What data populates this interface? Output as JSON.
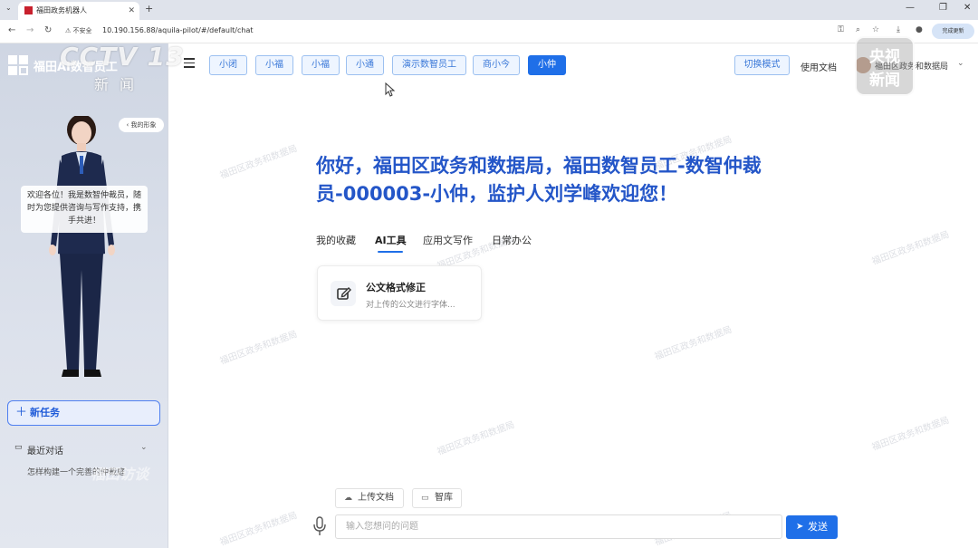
{
  "browser": {
    "tab_title": "福田政务机器人",
    "url_security": "不安全",
    "url": "10.190.156.88/aquila-pilot/#/default/chat",
    "profile_label": "完成更新"
  },
  "sidebar": {
    "brand": "福田AI数智员工",
    "my_avatar": "我的形象",
    "greeting": "欢迎各位！我是数智仲裁员，随时为您提供咨询与写作支持，携手共进！",
    "new_task": "新任务",
    "recent_label": "最近对话",
    "recent_items": [
      "怎样构建一个完善的仲裁庭"
    ]
  },
  "topnav": {
    "agent_tabs": [
      "小闭",
      "小福",
      "小福",
      "小通",
      "演示数智员工",
      "商小今",
      "小仲"
    ],
    "active_tab_index": 6,
    "switch_mode": "切换模式",
    "usage_doc": "使用文档",
    "user_name": "福田区政务和数据局"
  },
  "main": {
    "headline": "你好，福田区政务和数据局，福田数智员工-数智仲裁员-000003-小仲，监护人刘学峰欢迎您！",
    "tabs": [
      "我的收藏",
      "AI工具",
      "应用文写作",
      "日常办公"
    ],
    "active_tab_index": 1,
    "tools": [
      {
        "title": "公文格式修正",
        "desc": "对上传的公文进行字体..."
      }
    ],
    "watermark": "福田区政务和数据局"
  },
  "composer": {
    "upload_label": "上传文档",
    "kb_label": "智库",
    "placeholder": "输入您想问的问题",
    "send_label": "发送"
  },
  "overlay": {
    "cctv_logo": "CCTV 13",
    "cctv_sub": "新闻",
    "news_line1": "央视",
    "news_line2": "新闻",
    "bottom_watermark": "福田访谈"
  },
  "colors": {
    "accent": "#1f6fe8",
    "headline": "#2456c8",
    "sidebar_bg": "#d6dce7",
    "tab_border": "#9cc0f0"
  }
}
